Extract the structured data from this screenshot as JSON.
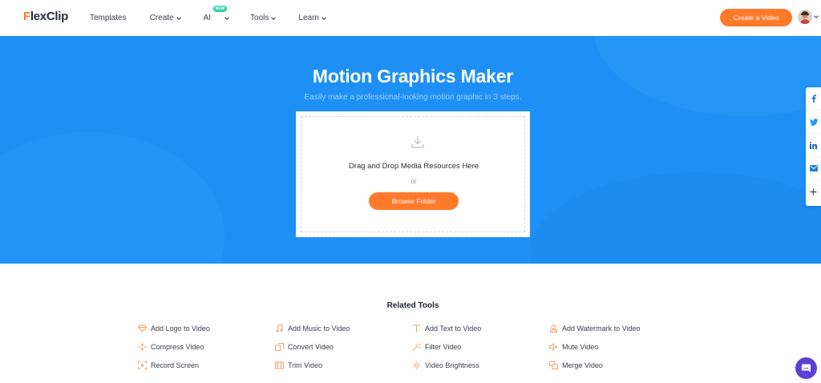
{
  "header": {
    "logo": "FlexClip",
    "nav": [
      {
        "label": "Templates",
        "dropdown": false
      },
      {
        "label": "Create",
        "dropdown": true
      },
      {
        "label": "AI",
        "dropdown": true,
        "badge": "NEW"
      },
      {
        "label": "Tools",
        "dropdown": true
      },
      {
        "label": "Learn",
        "dropdown": true
      }
    ],
    "cta": "Create a Video"
  },
  "hero": {
    "title": "Motion Graphics Maker",
    "subtitle": "Easily make a professional-looking motion graphic in 3 steps.",
    "drop_text": "Drag and Drop Media Resources Here",
    "or_text": "or",
    "browse_label": "Browse Folder"
  },
  "share": [
    "facebook-icon",
    "twitter-icon",
    "linkedin-icon",
    "email-icon",
    "plus-icon"
  ],
  "related": {
    "title": "Related Tools",
    "tools": [
      [
        "Add Logo to Video",
        "Add Music to Video",
        "Add Text to Video",
        "Add Watermark to Video"
      ],
      [
        "Compress Video",
        "Convert Video",
        "Filter Video",
        "Mute Video"
      ],
      [
        "Record Screen",
        "Trim Video",
        "Video Brightness",
        "Merge Video"
      ]
    ]
  },
  "colors": {
    "accent": "#ff7a2b",
    "hero_bg": "#1e90f5",
    "icon": "#e8a36b",
    "chat": "#5b3fd6"
  }
}
